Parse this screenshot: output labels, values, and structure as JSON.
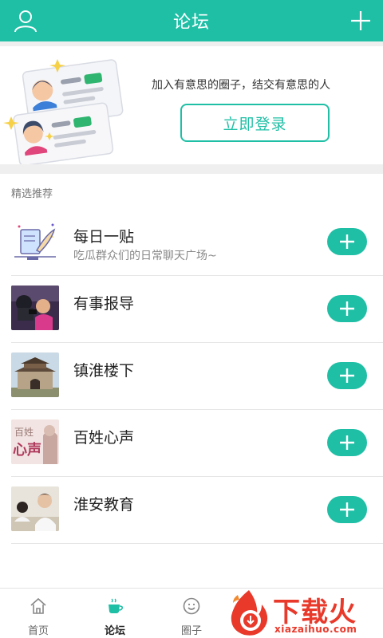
{
  "header": {
    "title": "论坛",
    "user_icon": "user-icon",
    "plus_icon": "plus-icon"
  },
  "banner": {
    "slogan": "加入有意思的圈子，结交有意思的人",
    "login_label": "立即登录"
  },
  "section": {
    "title": "精选推荐"
  },
  "forums": [
    {
      "name": "每日一贴",
      "desc": "吃瓜群众们的日常聊天广场~",
      "thumb": "quill-paper-icon"
    },
    {
      "name": "有事报导",
      "desc": "",
      "thumb": "reporter-photo"
    },
    {
      "name": "镇淮楼下",
      "desc": "",
      "thumb": "tower-photo"
    },
    {
      "name": "百姓心声",
      "desc": "",
      "thumb": "voice-photo",
      "thumb_text": [
        "百姓",
        "心声"
      ]
    },
    {
      "name": "淮安教育",
      "desc": "",
      "thumb": "classroom-photo"
    }
  ],
  "tabs": [
    {
      "label": "首页",
      "icon": "home-icon",
      "active": false
    },
    {
      "label": "论坛",
      "icon": "coffee-cup-icon",
      "active": true
    },
    {
      "label": "圈子",
      "icon": "smile-circle-icon",
      "active": false
    }
  ],
  "watermark": {
    "text": "下载火",
    "domain": "xiazaihuo.com"
  },
  "colors": {
    "accent": "#1fbfa6",
    "watermark": "#e8392b"
  }
}
